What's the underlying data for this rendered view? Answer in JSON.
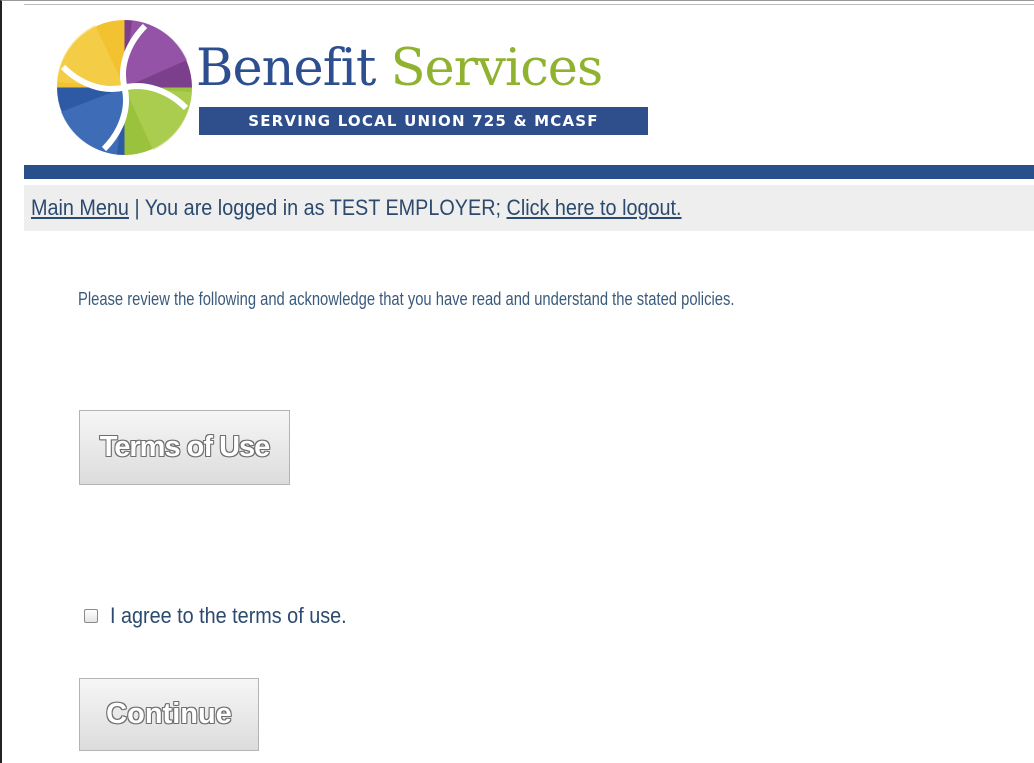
{
  "brand": {
    "name_part1": "Benefit",
    "name_part2": "Services",
    "tagline": "SERVING LOCAL UNION 725 & MCASF",
    "logo_icon": "pinwheel-logo-icon"
  },
  "nav": {
    "main_menu_link": "Main Menu",
    "separator": "|",
    "logged_in_text": "You are logged in as TEST EMPLOYER;",
    "logout_link": "Click here to logout."
  },
  "content": {
    "instructions": "Please review the following and acknowledge that you have read and understand the stated policies.",
    "terms_button": "Terms of Use",
    "agree_label": "I agree to the terms of use.",
    "agree_checked": false,
    "continue_button": "Continue"
  },
  "colors": {
    "brand_blue": "#27508d",
    "brand_green": "#8fb32f",
    "nav_background": "#eeeeee",
    "text_blue": "#2c4a6e",
    "logo_yellow": "#f2c230",
    "logo_purple": "#7b3f8c",
    "logo_light_purple": "#a05cb0",
    "logo_green": "#9ac23c",
    "logo_blue": "#2e5aa4"
  }
}
